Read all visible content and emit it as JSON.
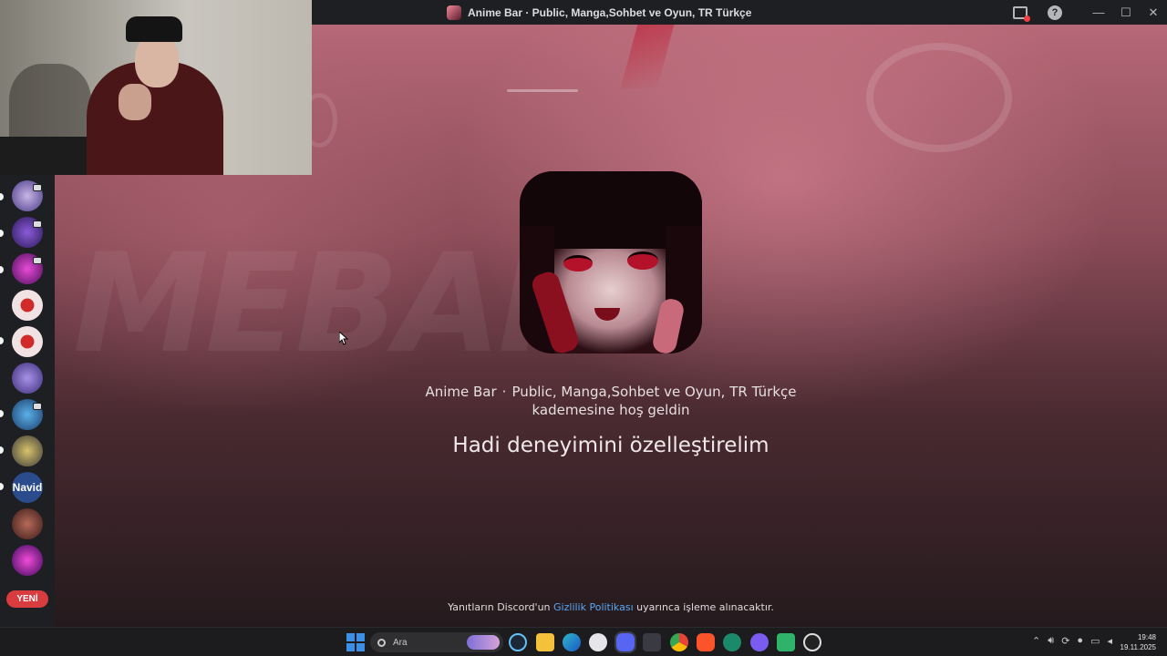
{
  "window": {
    "title": "Anime Bar  · Public, Manga,Sohbet ve Oyun, TR Türkçe"
  },
  "titlebar_icons": [
    "inbox-icon",
    "help-icon",
    "minimize-icon",
    "maximize-icon",
    "close-icon"
  ],
  "help_glyph": "?",
  "window_controls": {
    "minimize": "—",
    "maximize": "☐",
    "close": "✕"
  },
  "rail": {
    "servers": [
      "server-1",
      "server-2",
      "server-3",
      "server-4",
      "server-5",
      "server-6",
      "server-7",
      "server-8",
      "navid-server",
      "server-10",
      "server-11"
    ],
    "navid_label": "Navid",
    "new_badge": "YENİ"
  },
  "onboarding": {
    "server_name": "Anime Bar",
    "server_tagline": "Public, Manga,Sohbet ve Oyun, TR Türkçe",
    "welcome_suffix": "kademesine hoş geldin",
    "headline": "Hadi deneyimini özelleştirelim",
    "privacy_prefix": "Yanıtların Discord'un",
    "privacy_link": "Gizlilik Politikası",
    "privacy_suffix": "uyarınca işleme alınacaktır."
  },
  "taskbar": {
    "search_placeholder": "Ara",
    "time": "19:48",
    "date": "19.11.2025",
    "apps": [
      "steam-icon",
      "file-explorer-icon",
      "edge-icon",
      "game-icon",
      "discord-icon",
      "app-icon",
      "chrome-icon",
      "brave-icon",
      "app2-icon",
      "app3-icon",
      "app4-icon",
      "obs-icon"
    ]
  },
  "colors": {
    "accent_link": "#5aa6f2",
    "new_badge": "#d83c3e",
    "windows_blue": "#3c8fe6"
  }
}
